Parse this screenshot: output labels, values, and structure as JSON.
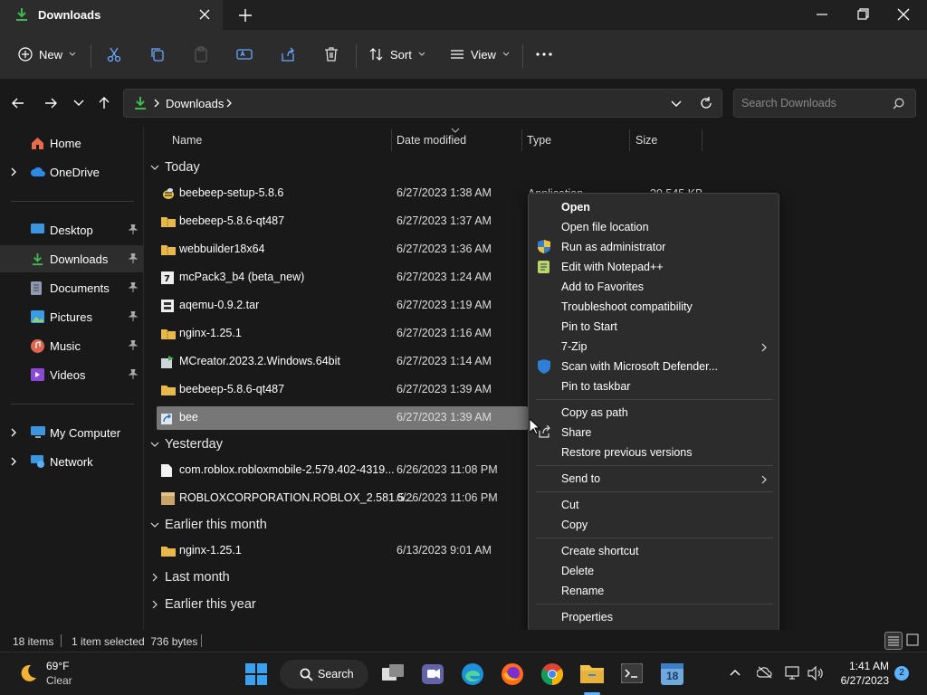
{
  "window": {
    "tab_title": "Downloads"
  },
  "toolbar": {
    "new_label": "New",
    "sort_label": "Sort",
    "view_label": "View"
  },
  "address": {
    "crumb": "Downloads",
    "search_placeholder": "Search Downloads"
  },
  "sidebar": {
    "items": [
      {
        "label": "Home",
        "icon": "home-icon"
      },
      {
        "label": "OneDrive",
        "icon": "cloud-icon"
      },
      {
        "label": "Desktop",
        "icon": "desktop-icon"
      },
      {
        "label": "Downloads",
        "icon": "download-icon"
      },
      {
        "label": "Documents",
        "icon": "document-icon"
      },
      {
        "label": "Pictures",
        "icon": "pictures-icon"
      },
      {
        "label": "Music",
        "icon": "music-icon"
      },
      {
        "label": "Videos",
        "icon": "video-icon"
      },
      {
        "label": "My Computer",
        "icon": "computer-icon"
      },
      {
        "label": "Network",
        "icon": "network-icon"
      }
    ]
  },
  "columns": {
    "name": "Name",
    "date": "Date modified",
    "type": "Type",
    "size": "Size"
  },
  "groups": {
    "today": "Today",
    "yesterday": "Yesterday",
    "earlier_month": "Earlier this month",
    "last_month": "Last month",
    "earlier_year": "Earlier this year"
  },
  "files": [
    {
      "name": "beebeep-setup-5.8.6",
      "date": "6/27/2023 1:38 AM"
    },
    {
      "name": "beebeep-5.8.6-qt487",
      "date": "6/27/2023 1:37 AM"
    },
    {
      "name": "webbuilder18x64",
      "date": "6/27/2023 1:36 AM"
    },
    {
      "name": "mcPack3_b4 (beta_new)",
      "date": "6/27/2023 1:24 AM"
    },
    {
      "name": "aqemu-0.9.2.tar",
      "date": "6/27/2023 1:19 AM"
    },
    {
      "name": "nginx-1.25.1",
      "date": "6/27/2023 1:16 AM"
    },
    {
      "name": "MCreator.2023.2.Windows.64bit",
      "date": "6/27/2023 1:14 AM"
    },
    {
      "name": "beebeep-5.8.6-qt487",
      "date": "6/27/2023 1:39 AM"
    },
    {
      "name": "bee",
      "date": "6/27/2023 1:39 AM"
    },
    {
      "name": "com.roblox.robloxmobile-2.579.402-4319...",
      "date": "6/26/2023 11:08 PM"
    },
    {
      "name": "ROBLOXCORPORATION.ROBLOX_2.581.5...",
      "date": "6/26/2023 11:06 PM"
    },
    {
      "name": "nginx-1.25.1",
      "date": "6/13/2023 9:01 AM"
    }
  ],
  "partial": {
    "type0": "Application",
    "size0": "39,545 KB"
  },
  "context_menu": {
    "open": "Open",
    "open_location": "Open file location",
    "run_admin": "Run as administrator",
    "edit_notepad": "Edit with Notepad++",
    "add_favorites": "Add to Favorites",
    "troubleshoot": "Troubleshoot compatibility",
    "pin_start": "Pin to Start",
    "zip": "7-Zip",
    "defender": "Scan with Microsoft Defender...",
    "pin_taskbar": "Pin to taskbar",
    "copy_path": "Copy as path",
    "share": "Share",
    "restore": "Restore previous versions",
    "send_to": "Send to",
    "cut": "Cut",
    "copy": "Copy",
    "create_shortcut": "Create shortcut",
    "delete": "Delete",
    "rename": "Rename",
    "properties": "Properties"
  },
  "status": {
    "items": "18 items",
    "selected": "1 item selected  736 bytes"
  },
  "taskbar": {
    "weather_temp": "69°F",
    "weather_cond": "Clear",
    "search_label": "Search",
    "time": "1:41 AM",
    "date": "6/27/2023",
    "notif_count": "2",
    "calendar_day": "18"
  },
  "colors": {
    "accent": "#0078d4",
    "folder": "#e8b84a",
    "green": "#3fb950"
  }
}
